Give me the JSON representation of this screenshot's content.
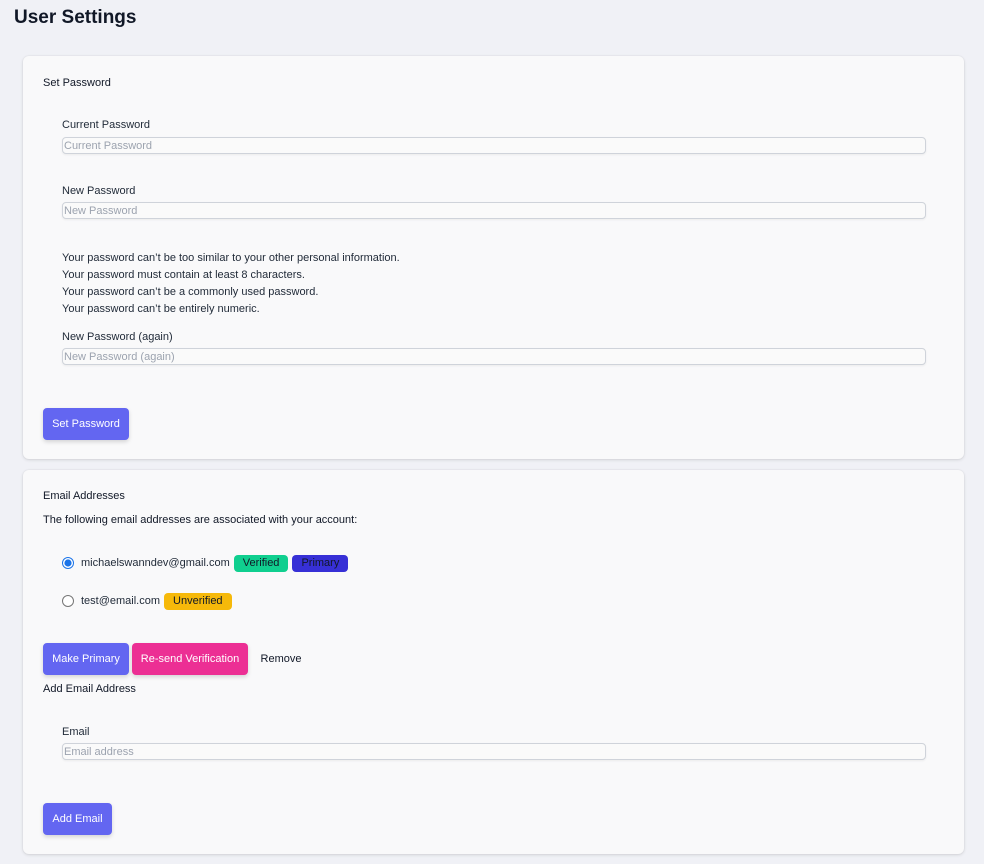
{
  "page": {
    "title": "User Settings"
  },
  "password_section": {
    "title": "Set Password",
    "current": {
      "label": "Current Password",
      "placeholder": "Current Password"
    },
    "new": {
      "label": "New Password",
      "placeholder": "New Password"
    },
    "help": [
      "Your password can’t be too similar to your other personal information.",
      "Your password must contain at least 8 characters.",
      "Your password can’t be a commonly used password.",
      "Your password can’t be entirely numeric."
    ],
    "again": {
      "label": "New Password (again)",
      "placeholder": "New Password (again)"
    },
    "submit_label": "Set Password"
  },
  "email_section": {
    "title": "Email Addresses",
    "description": "The following email addresses are associated with your account:",
    "emails": [
      {
        "address": "michaelswanndev@gmail.com",
        "selected": true,
        "badges": [
          {
            "text": "Verified",
            "color": "#10cf8f"
          },
          {
            "text": "Primary",
            "color": "#3730d6"
          }
        ]
      },
      {
        "address": "test@email.com",
        "selected": false,
        "badges": [
          {
            "text": "Unverified",
            "color": "#f6b90a"
          }
        ]
      }
    ],
    "make_primary_label": "Make Primary",
    "resend_label": "Re-send Verification",
    "remove_label": "Remove",
    "add_title": "Add Email Address",
    "email_field": {
      "label": "Email",
      "placeholder": "Email address"
    },
    "add_label": "Add Email"
  },
  "colors": {
    "accent": "#6366f1",
    "pink": "#ec2f94",
    "background": "#f0f1f6",
    "card": "#f9f9fa"
  }
}
